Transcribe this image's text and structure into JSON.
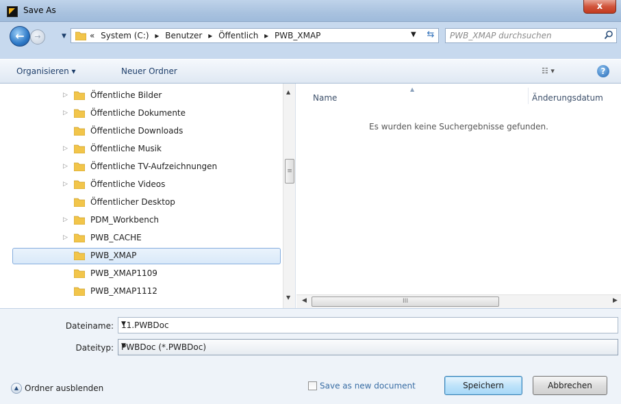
{
  "window": {
    "title": "Save As",
    "close_glyph": "x"
  },
  "nav": {
    "back_glyph": "←",
    "forward_glyph": "→"
  },
  "address": {
    "segments": [
      "«",
      "System (C:)",
      "▸",
      "Benutzer",
      "▸",
      "Öffentlich",
      "▸",
      "PWB_XMAP"
    ]
  },
  "search": {
    "placeholder": "PWB_XMAP durchsuchen"
  },
  "toolbar": {
    "organize_label": "Organisieren ▾",
    "new_folder_label": "Neuer Ordner",
    "view_label": "☷ ▾",
    "help_label": "?"
  },
  "tree": {
    "items": [
      {
        "label": "Öffentliche Bilder",
        "has_arrow": true
      },
      {
        "label": "Öffentliche Dokumente",
        "has_arrow": true
      },
      {
        "label": "Öffentliche Downloads",
        "has_arrow": false
      },
      {
        "label": "Öffentliche Musik",
        "has_arrow": true
      },
      {
        "label": "Öffentliche TV-Aufzeichnungen",
        "has_arrow": true
      },
      {
        "label": "Öffentliche Videos",
        "has_arrow": true
      },
      {
        "label": "Öffentlicher Desktop",
        "has_arrow": false
      },
      {
        "label": "PDM_Workbench",
        "has_arrow": true
      },
      {
        "label": "PWB_CACHE",
        "has_arrow": true
      },
      {
        "label": "PWB_XMAP",
        "has_arrow": false,
        "selected": true
      },
      {
        "label": "PWB_XMAP1109",
        "has_arrow": false
      },
      {
        "label": "PWB_XMAP1112",
        "has_arrow": false
      }
    ]
  },
  "filelist": {
    "col_name": "Name",
    "col_date": "Änderungsdatum",
    "empty_message": "Es wurden keine Suchergebnisse gefunden."
  },
  "form": {
    "filename_label": "Dateiname:",
    "filename_value": "11.PWBDoc",
    "filetype_label": "Dateityp:",
    "filetype_value": "PWBDoc (*.PWBDoc)"
  },
  "footer": {
    "hide_folders_label": "Ordner ausblenden",
    "save_new_label": "Save as new document",
    "save_button": "Speichern",
    "cancel_button": "Abbrechen"
  },
  "colors": {
    "folder": "#f2c54a",
    "accent": "#3c7fb1",
    "titlebar": "#a9c2df"
  }
}
